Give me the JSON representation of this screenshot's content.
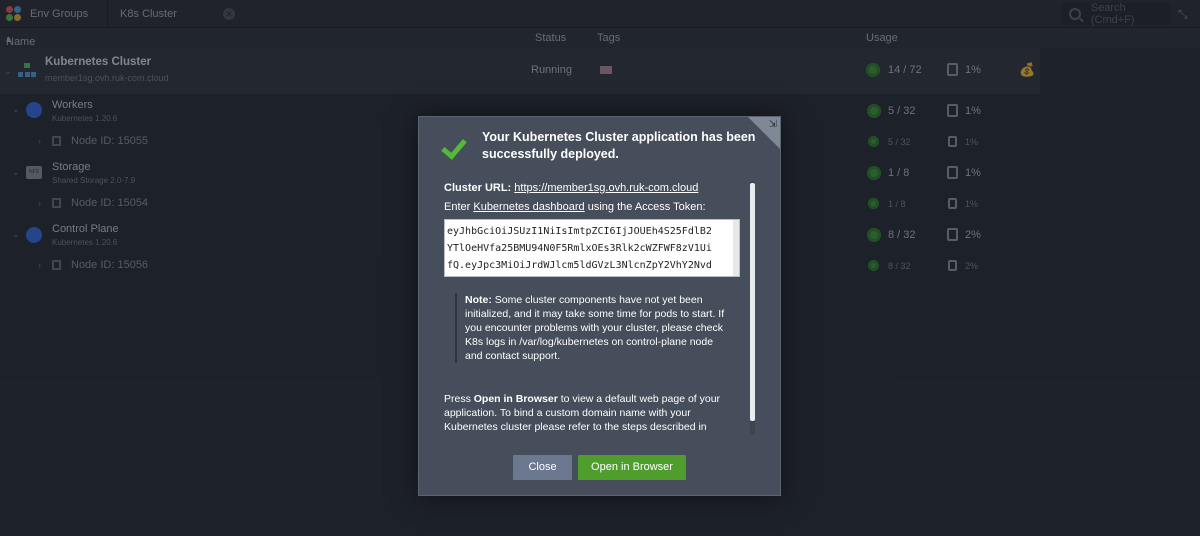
{
  "tabs": {
    "env_groups": "Env Groups",
    "k8s_cluster": "K8s Cluster",
    "search_placeholder": "Search (Cmd+F)"
  },
  "columns": {
    "name": "Name",
    "status": "Status",
    "tags": "Tags",
    "usage": "Usage"
  },
  "env": {
    "title": "Kubernetes Cluster",
    "domain": "member1sg.ovh.ruk-com.cloud",
    "status": "Running",
    "usage": "14 / 72",
    "disk": "1%"
  },
  "groups": [
    {
      "title": "Workers",
      "sub": "Kubernetes 1.20.6",
      "usage": "5 / 32",
      "disk": "1%",
      "node": "Node ID: 15055",
      "node_usage": "5 / 32",
      "node_disk": "1%"
    },
    {
      "title": "Storage",
      "sub": "Shared Storage 2.0-7.9",
      "usage": "1 / 8",
      "disk": "1%",
      "node": "Node ID: 15054",
      "node_usage": "1 / 8",
      "node_disk": "1%"
    },
    {
      "title": "Control Plane",
      "sub": "Kubernetes 1.20.6",
      "usage": "8 / 32",
      "disk": "2%",
      "node": "Node ID: 15056",
      "node_usage": "8 / 32",
      "node_disk": "2%"
    }
  ],
  "dialog": {
    "title": "Your Kubernetes Cluster application has been successfully deployed.",
    "cluster_url_label": "Cluster URL:",
    "cluster_url": "https://member1sg.ovh.ruk-com.cloud",
    "enter_prefix": "Enter ",
    "dashboard_link": "Kubernetes dashboard",
    "enter_suffix": " using the Access Token:",
    "token_lines": [
      "eyJhbGciOiJSUzI1NiIsImtpZCI6IjJOUEh4S25FdlB2",
      "YTlOeHVfa25BMU94N0F5RmlxOEs3Rlk2cWZFWF8zV1Ui",
      "fQ.eyJpc3MiOiJrdWJlcm5ldGVzL3NlcnZpY2VhY2Nvd"
    ],
    "note_label": "Note:",
    "note_text": " Some cluster components have not yet been initialized, and it may take some time for pods to start. If you encounter problems with your cluster, please check K8s logs in /var/log/kubernetes on control-plane node and contact support.",
    "press_prefix": "Press ",
    "press_bold": "Open in Browser",
    "press_text": " to view a default web page of your application. To bind a custom domain name with your Kubernetes cluster please refer to the steps described in",
    "close_label": "Close",
    "open_label": "Open in Browser"
  },
  "colors": {
    "running_green": "#3c9a3a",
    "open_button": "#4f9e2d",
    "close_button": "#6c7890",
    "dialog_bg": "#454e5a"
  }
}
